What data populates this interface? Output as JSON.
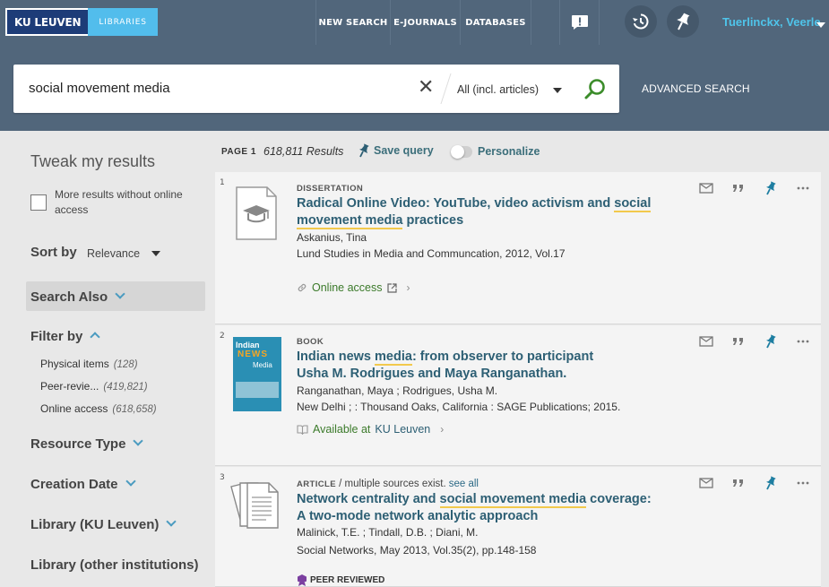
{
  "header": {
    "logo_main": "KU LEUVEN",
    "logo_sub": "LIBRARIES",
    "nav": [
      "NEW SEARCH",
      "E-JOURNALS",
      "DATABASES"
    ],
    "user_name": "Tuerlinckx, Veerle"
  },
  "search": {
    "query": "social movement media",
    "scope": "All (incl. articles)",
    "advanced_label": "ADVANCED SEARCH"
  },
  "sidebar": {
    "title": "Tweak my results",
    "checkbox_label": "More results without online access",
    "sort_label": "Sort by",
    "sort_value": "Relevance",
    "search_also": "Search Also",
    "filter_by": "Filter by",
    "filters": [
      {
        "label": "Physical items",
        "count": "(128)"
      },
      {
        "label": "Peer-revie...",
        "count": "(419,821)"
      },
      {
        "label": "Online access",
        "count": "(618,658)"
      }
    ],
    "facets": [
      "Resource Type",
      "Creation Date",
      "Library (KU Leuven)",
      "Library (other institutions)"
    ]
  },
  "results_header": {
    "page_label": "PAGE 1",
    "count": "618,811",
    "count_suffix": "Results",
    "save_query": "Save query",
    "personalize": "Personalize"
  },
  "results": [
    {
      "num": "1",
      "type": "DISSERTATION",
      "title_parts": [
        "Radical Online Video: YouTube, video activism and ",
        "social movement media",
        " practices"
      ],
      "author": "Askanius, Tina",
      "source": "Lund Studies in Media and Communcation, 2012, Vol.17",
      "access": "Online access"
    },
    {
      "num": "2",
      "type": "BOOK",
      "title_parts": [
        "Indian news ",
        "media",
        ": from observer to participant"
      ],
      "title_line2": "Usha M. Rodrigues and Maya Ranganathan.",
      "author": "Ranganathan, Maya ; Rodrigues, Usha M.",
      "source": "New Delhi ; : Thousand Oaks, California : SAGE Publications; 2015.",
      "access_pre": "Available at",
      "access_loc": "KU Leuven",
      "cover": {
        "line1": "Indian",
        "line2": "NEWS",
        "line3": "Media"
      }
    },
    {
      "num": "3",
      "type": "ARTICLE",
      "type_extra": " / multiple sources exist.",
      "see_all": "see all",
      "title_parts": [
        "Network centrality and ",
        "social movement media",
        " coverage:"
      ],
      "title_line2": "A two-mode network analytic approach",
      "author": "Malinick, T.E. ; Tindall, D.B. ; Diani, M.",
      "source": "Social Networks, May 2013, Vol.35(2), pp.148-158",
      "badge": "PEER REVIEWED"
    }
  ],
  "colors": {
    "header_bg": "#51667b",
    "accent_blue": "#4fc4ea",
    "link_teal": "#2d5f74",
    "green": "#3b7a2a",
    "highlight": "#f2c94c"
  }
}
